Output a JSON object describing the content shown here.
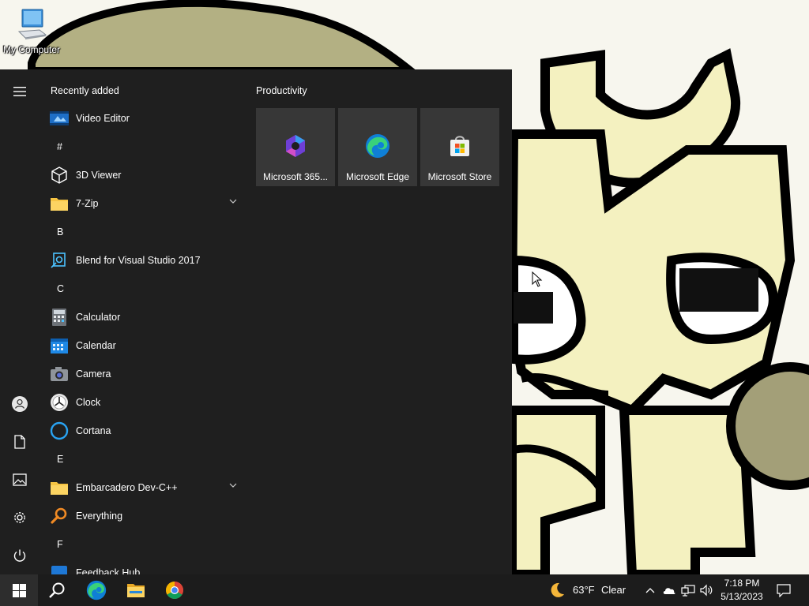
{
  "desktop": {
    "icons": [
      {
        "label": "My Computer",
        "icon": "computer-icon"
      }
    ]
  },
  "start_menu": {
    "rail": [
      {
        "icon": "hamburger-icon"
      },
      {
        "icon": "user-icon"
      },
      {
        "icon": "document-icon"
      },
      {
        "icon": "pictures-icon"
      },
      {
        "icon": "gear-icon"
      },
      {
        "icon": "power-icon"
      }
    ],
    "recent_title": "Recently added",
    "apps": {
      "video_editor": "Video Editor",
      "hash": "#",
      "viewer_3d": "3D Viewer",
      "zip": "7-Zip",
      "b": "B",
      "blend": "Blend for Visual Studio 2017",
      "c": "C",
      "calculator": "Calculator",
      "calendar": "Calendar",
      "camera": "Camera",
      "clock": "Clock",
      "cortana": "Cortana",
      "e": "E",
      "devcpp": "Embarcadero Dev-C++",
      "everything": "Everything",
      "f": "F",
      "feedback": "Feedback Hub"
    },
    "tiles_title": "Productivity",
    "tiles": [
      {
        "label": "Microsoft 365...",
        "icon": "microsoft-365-icon"
      },
      {
        "label": "Microsoft Edge",
        "icon": "edge-icon"
      },
      {
        "label": "Microsoft Store",
        "icon": "store-icon"
      }
    ]
  },
  "taskbar": {
    "pinned": [
      "windows-start-icon",
      "search-icon",
      "edge-icon",
      "file-explorer-icon",
      "chrome-icon"
    ],
    "weather": {
      "temp": "63°F",
      "condition": "Clear",
      "icon": "moon-icon"
    },
    "tray": [
      "chevron-up-icon",
      "onedrive-icon",
      "network-icon",
      "volume-icon"
    ],
    "time": "7:18 PM",
    "date": "5/13/2023",
    "notification_icon": "action-center-icon"
  },
  "colors": {
    "menu_bg": "#1f1f1f",
    "tile_bg": "#373737",
    "taskbar_bg": "#1c1c1c",
    "accent_blue": "#0078d4"
  }
}
